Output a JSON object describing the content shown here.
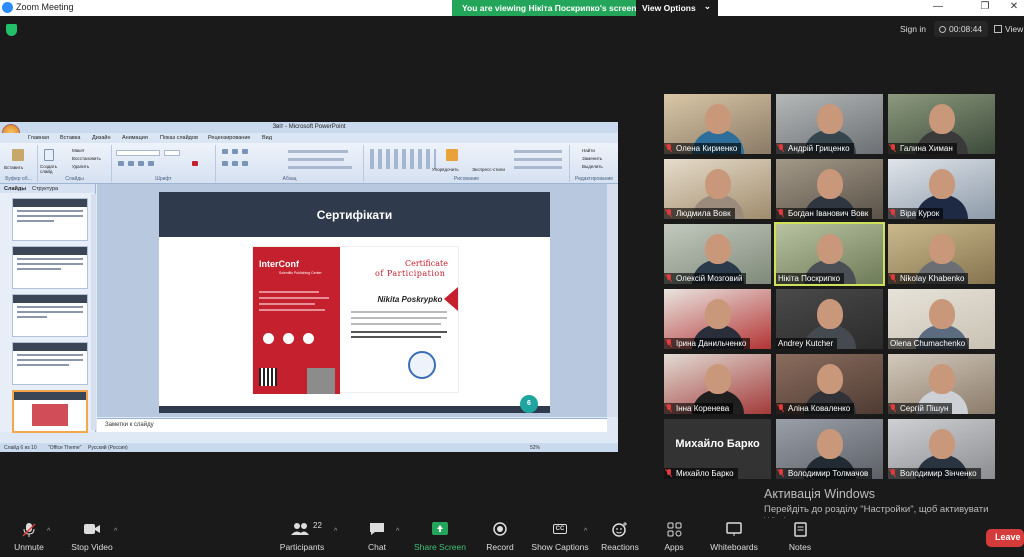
{
  "window": {
    "title": "Zoom Meeting",
    "minimize": "—",
    "maximize": "❐",
    "close": "✕"
  },
  "banner": {
    "text": "You are viewing Нікіта Поскрипко's screen",
    "options": "View Options",
    "options_caret": "⌄"
  },
  "header": {
    "sign_in": "Sign in",
    "timer": "00:08:44",
    "view": "View"
  },
  "ppt": {
    "title": "Звіт - Microsoft PowerPoint",
    "tabs": [
      "Главная",
      "Вставка",
      "Дизайн",
      "Анимация",
      "Показ слайдов",
      "Рецензирование",
      "Вид"
    ],
    "ribbon_groups": [
      "Буфер об...",
      "Слайды",
      "Шрифт",
      "Абзац",
      "Рисование",
      "Редактирование"
    ],
    "ribbon_buttons": {
      "paste": "Вставить",
      "create_slide": "Создать слайд",
      "layout": "Макет",
      "reset": "Восстановить",
      "delete": "Удалить",
      "arrange": "Упорядочить",
      "quick_styles": "Экспресс-стили",
      "find": "Найти",
      "replace": "Заменить",
      "select": "Выделить"
    },
    "pane_tabs": [
      "Слайды",
      "Структура"
    ],
    "slide_title": "Сертифікати",
    "slide_number": "6",
    "notes_placeholder": "Заметки к слайду",
    "status": {
      "slide": "Слайд 6 из 10",
      "theme": "\"Office Theme\"",
      "lang": "Русский (Россия)",
      "zoom": "52%"
    },
    "certificate": {
      "brand": "InterConf",
      "tagline": "Scientific Publishing Center",
      "heading1": "Certificate",
      "heading2": "of Participation",
      "name": "Nikita Poskrypko"
    }
  },
  "participants": [
    {
      "name": "Олена Кириенко",
      "muted": true
    },
    {
      "name": "Андрій Гриценко",
      "muted": true
    },
    {
      "name": "Галина Химан",
      "muted": true
    },
    {
      "name": "Людмила Вовк",
      "muted": true
    },
    {
      "name": "Богдан Іванович Вовк",
      "muted": true
    },
    {
      "name": "Віра Курок",
      "muted": true
    },
    {
      "name": "Олексій Мозговий",
      "muted": true
    },
    {
      "name": "Нікіта Поскрипко",
      "muted": false,
      "active": true
    },
    {
      "name": "Nikolay Khabenko",
      "muted": true
    },
    {
      "name": "Ірина Данильченко",
      "muted": true
    },
    {
      "name": "Andrey Kutcher",
      "muted": false
    },
    {
      "name": "Olena Chumachenko",
      "muted": false
    },
    {
      "name": "Інна Коренева",
      "muted": true
    },
    {
      "name": "Аліна Коваленко",
      "muted": true
    },
    {
      "name": "Сергій Пішун",
      "muted": true
    },
    {
      "name": "Михайло Барко",
      "muted": true,
      "video_off": true
    },
    {
      "name": "Володимир Толмачов",
      "muted": true
    },
    {
      "name": "Володимир Зінченко",
      "muted": true
    }
  ],
  "activation": {
    "title": "Активація Windows",
    "subtitle": "Перейдіть до розділу \"Настройки\", щоб активувати Windows."
  },
  "toolbar": {
    "unmute": "Unmute",
    "stop_video": "Stop Video",
    "participants": "Participants",
    "participants_count": "22",
    "chat": "Chat",
    "share_screen": "Share Screen",
    "record": "Record",
    "show_captions": "Show Captions",
    "reactions": "Reactions",
    "apps": "Apps",
    "whiteboards": "Whiteboards",
    "notes": "Notes",
    "leave": "Leave",
    "caret": "^",
    "cc": "CC"
  },
  "colors": {
    "accent_green": "#23a55a",
    "leave_red": "#d63b3b",
    "active_outline": "#cfe05a",
    "cert_red": "#c5202e"
  }
}
